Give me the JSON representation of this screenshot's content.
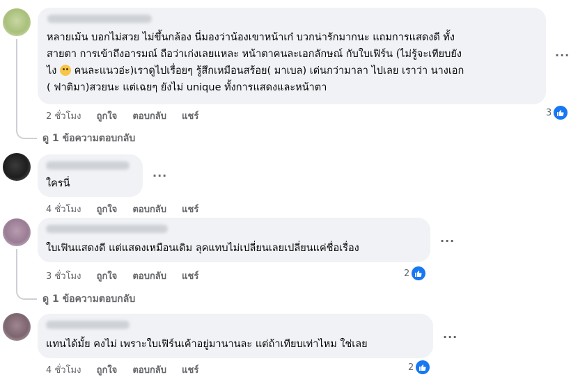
{
  "comments": [
    {
      "lines": [
        "หลายเม้น บอกไม่สวย ไม่ขึ้นกล้อง นี่มองว่าน้องเขาหน้าเก๋ บวกน่ารักมากนะ แถมการแสดงดี ทั้ง",
        "สายตา การเข้าถึงอารมณ์ ถือว่าเก่งเลยแหละ หน้าตาคนละเอกลักษณ์ กับใบเฟิร์น (ไม่รู้จะเทียบยัง",
        "ไง",
        "คนละแนวอ่ะ)เราดูไปเรื่อยๆ รู้สึกเหมือนสร้อย( มาเบล) เด่นกว่ามาลา ไปเลย เราว่า นางเอก",
        "( ฟาติมา)สวยนะ แต่เฉยๆ ยังไม่ unique ทั้งการแสดงและหน้าตา"
      ],
      "time": "2 ชั่วโมง",
      "like": "ถูกใจ",
      "reply": "ตอบกลับ",
      "share": "แชร์",
      "reactions": "3",
      "replies_link": "ดู 1 ข้อความตอบกลับ"
    },
    {
      "lines": [
        "ใครนี่"
      ],
      "time": "4 ชั่วโมง",
      "like": "ถูกใจ",
      "reply": "ตอบกลับ",
      "share": "แชร์"
    },
    {
      "lines": [
        "ใบเฟินแสดงดี แต่แสดงเหมือนเดิม ลุคแทบไม่เปลี่ยนเลยเปลี่ยนแค่ชื่อเรื่อง"
      ],
      "time": "3 ชั่วโมง",
      "like": "ถูกใจ",
      "reply": "ตอบกลับ",
      "share": "แชร์",
      "reactions": "2",
      "replies_link": "ดู 1 ข้อความตอบกลับ"
    },
    {
      "lines": [
        "แทนได้มั้ย คงไม่ เพราะใบเฟิร์นเค้าอยู่มานานละ แต่ถ้าเทียบเท่าไหม ใช่เลย"
      ],
      "time": "4 ชั่วโมง",
      "like": "ถูกใจ",
      "reply": "ตอบกลับ",
      "share": "แชร์",
      "reactions": "2"
    }
  ],
  "more_label": "···",
  "colors": {
    "bubble": "#f0f2f5",
    "meta": "#65676b",
    "like_blue": "#1877f2"
  },
  "icons": {
    "like": "thumbs-up-icon",
    "more": "more-options-icon",
    "emoji": "sad-face-emoji-icon"
  }
}
